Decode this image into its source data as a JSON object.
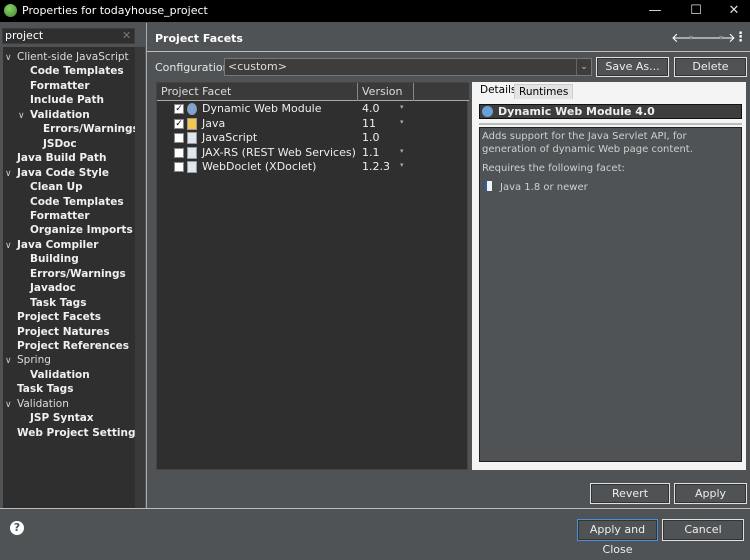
{
  "window": {
    "title": "Properties for todayhouse_project",
    "minimize": "—",
    "maximize": "☐",
    "close": "✕"
  },
  "sidebar": {
    "filter": "project",
    "clear": "✕",
    "items": [
      {
        "label": "Client-side JavaScript",
        "level": 0,
        "expanded": true,
        "bold": false
      },
      {
        "label": "Code Templates",
        "level": 1,
        "bold": true
      },
      {
        "label": "Formatter",
        "level": 1,
        "bold": true
      },
      {
        "label": "Include Path",
        "level": 1,
        "bold": true
      },
      {
        "label": "Validation",
        "level": 1,
        "expanded": true,
        "bold": true
      },
      {
        "label": "Errors/Warnings",
        "level": 2,
        "bold": true
      },
      {
        "label": "JSDoc",
        "level": 2,
        "bold": true
      },
      {
        "label": "Java Build Path",
        "level": 0,
        "bold": true
      },
      {
        "label": "Java Code Style",
        "level": 0,
        "expanded": true,
        "bold": true
      },
      {
        "label": "Clean Up",
        "level": 1,
        "bold": true
      },
      {
        "label": "Code Templates",
        "level": 1,
        "bold": true
      },
      {
        "label": "Formatter",
        "level": 1,
        "bold": true
      },
      {
        "label": "Organize Imports",
        "level": 1,
        "bold": true
      },
      {
        "label": "Java Compiler",
        "level": 0,
        "expanded": true,
        "bold": true
      },
      {
        "label": "Building",
        "level": 1,
        "bold": true
      },
      {
        "label": "Errors/Warnings",
        "level": 1,
        "bold": true
      },
      {
        "label": "Javadoc",
        "level": 1,
        "bold": true
      },
      {
        "label": "Task Tags",
        "level": 1,
        "bold": true
      },
      {
        "label": "Project Facets",
        "level": 0,
        "bold": true
      },
      {
        "label": "Project Natures",
        "level": 0,
        "bold": true
      },
      {
        "label": "Project References",
        "level": 0,
        "bold": true
      },
      {
        "label": "Spring",
        "level": 0,
        "expanded": true,
        "bold": false
      },
      {
        "label": "Validation",
        "level": 1,
        "bold": true
      },
      {
        "label": "Task Tags",
        "level": 0,
        "bold": true
      },
      {
        "label": "Validation",
        "level": 0,
        "expanded": true,
        "bold": false
      },
      {
        "label": "JSP Syntax",
        "level": 1,
        "bold": true
      },
      {
        "label": "Web Project Settings",
        "level": 0,
        "bold": true
      }
    ]
  },
  "page": {
    "title": "Project Facets",
    "back": "🡐",
    "forward": "🡒",
    "menu": "⋮",
    "dropdown": "▾"
  },
  "config": {
    "label": "Configuration:",
    "value": "<custom>",
    "save_as": "Save As...",
    "delete": "Delete"
  },
  "table": {
    "headers": [
      "Project Facet",
      "Version"
    ],
    "rows": [
      {
        "name": "Dynamic Web Module",
        "version": "4.0",
        "checked": true,
        "icon": "web",
        "dropdown": true
      },
      {
        "name": "Java",
        "version": "11",
        "checked": true,
        "icon": "java",
        "dropdown": true
      },
      {
        "name": "JavaScript",
        "version": "1.0",
        "checked": false,
        "icon": "doc",
        "dropdown": false
      },
      {
        "name": "JAX-RS (REST Web Services)",
        "version": "1.1",
        "checked": false,
        "icon": "doc",
        "dropdown": true
      },
      {
        "name": "WebDoclet (XDoclet)",
        "version": "1.2.3",
        "checked": false,
        "icon": "doc",
        "dropdown": true
      }
    ]
  },
  "details": {
    "tabs": [
      "Details",
      "Runtimes"
    ],
    "heading": "Dynamic Web Module 4.0",
    "description": "Adds support for the Java Servlet API, for generation of dynamic Web page content.",
    "requires_label": "Requires the following facet:",
    "requirement": "Java 1.8 or newer"
  },
  "buttons": {
    "revert": "Revert",
    "apply": "Apply",
    "apply_close": "Apply and Close",
    "cancel": "Cancel",
    "help": "?"
  },
  "colors": {
    "accent": "#4a90d9"
  }
}
